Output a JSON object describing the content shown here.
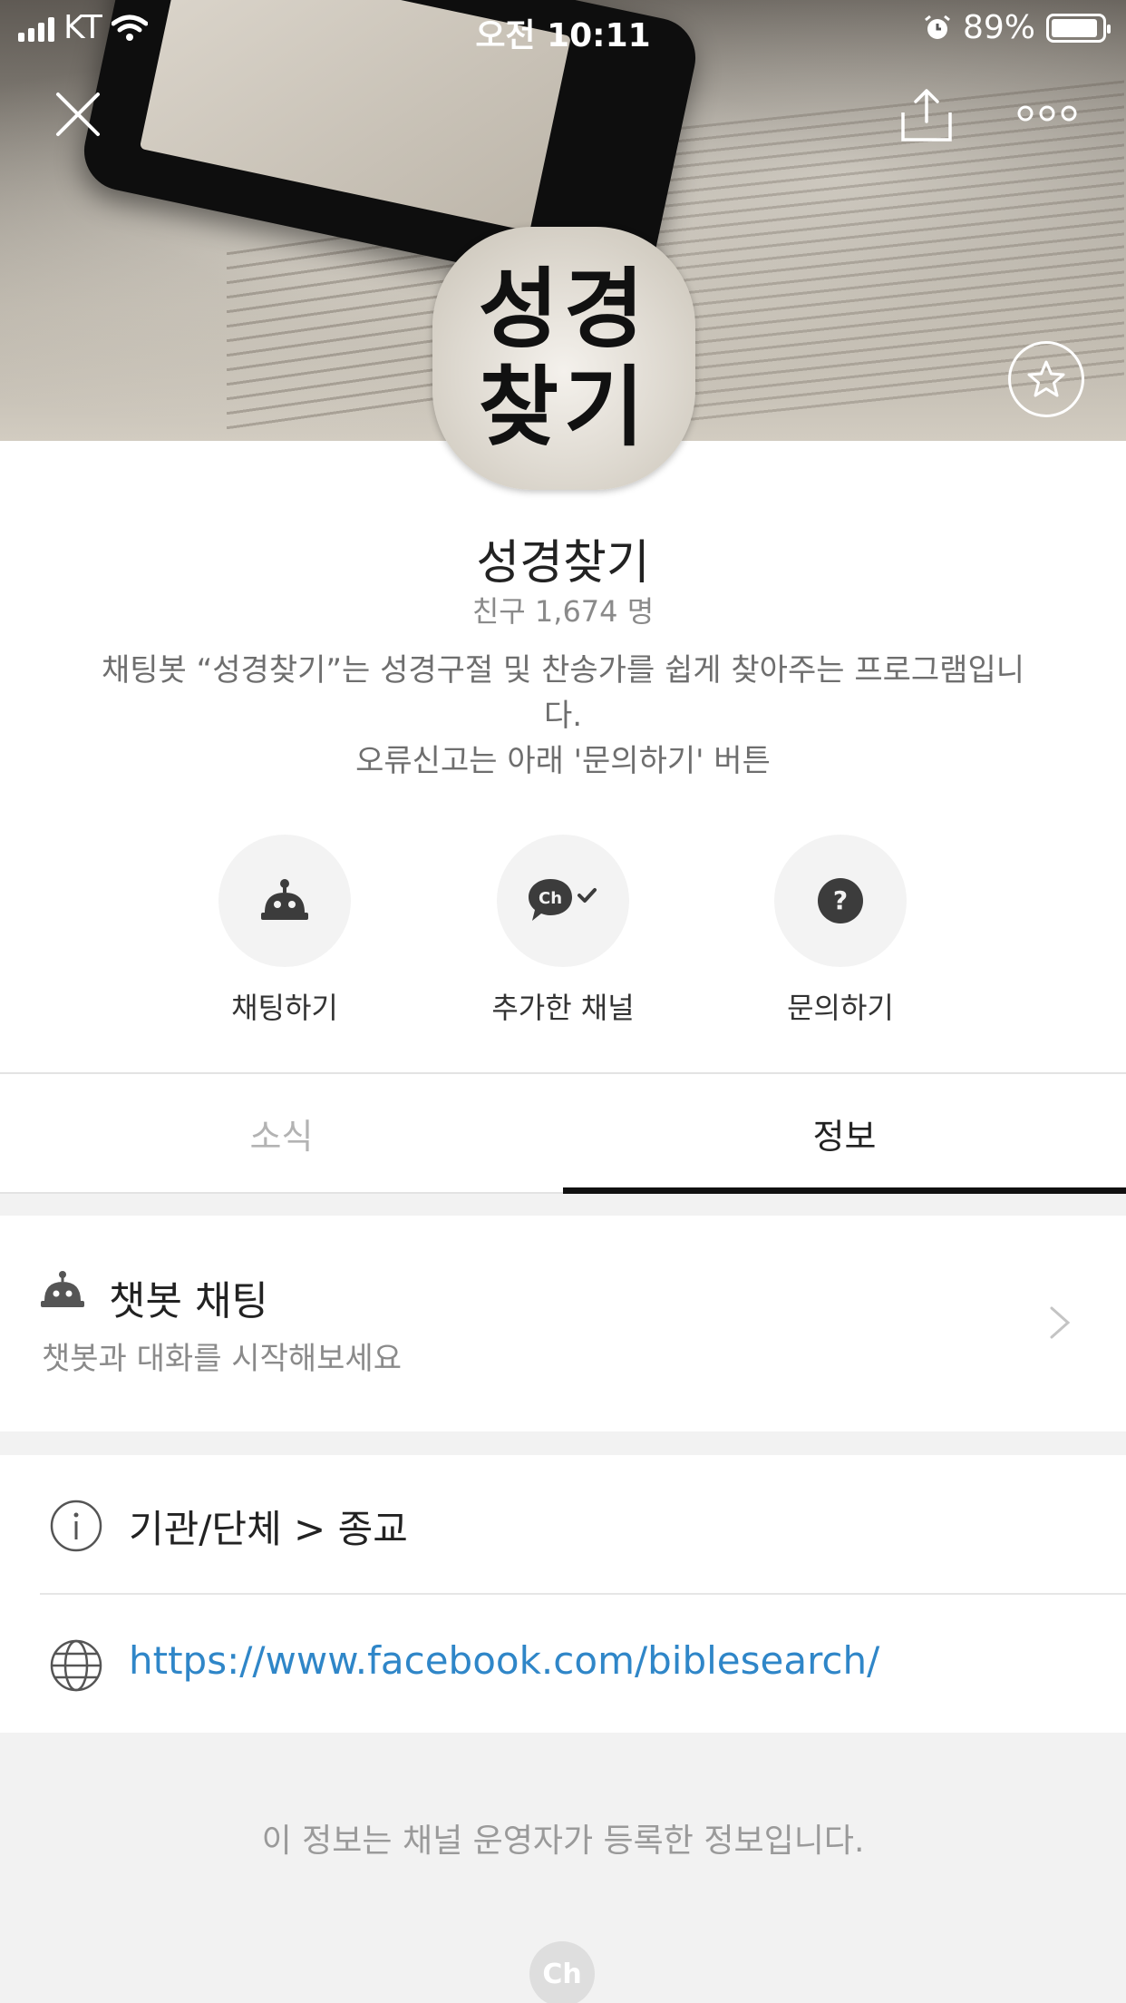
{
  "status_bar": {
    "carrier": "KT",
    "time": "오전 10:11",
    "battery": "89%"
  },
  "profile": {
    "avatar_text_line1": "성경",
    "avatar_text_line2": "찾기",
    "name": "성경찾기",
    "friends": "친구 1,674 명",
    "description": "채팅봇 “성경찾기”는 성경구절 및 찬송가를 쉽게 찾아주는 프로그램입니다.",
    "description_line2": "오류신고는 아래 '문의하기' 버튼"
  },
  "actions": [
    {
      "label": "채팅하기",
      "icon": "robot-icon"
    },
    {
      "label": "추가한 채널",
      "icon": "channel-added-icon"
    },
    {
      "label": "문의하기",
      "icon": "question-icon"
    }
  ],
  "tabs": {
    "news": "소식",
    "info": "정보",
    "active": "info"
  },
  "chatbot": {
    "title": "챗봇 채팅",
    "subtitle": "챗봇과 대화를 시작해보세요"
  },
  "info": {
    "category": "기관/단체 > 종교",
    "url": "https://www.facebook.com/biblesearch/"
  },
  "footer": {
    "note": "이 정보는 채널 운영자가 등록한 정보입니다.",
    "logo": "Ch"
  },
  "colors": {
    "link": "#2f86c8",
    "tab_indicator": "#111111",
    "background": "#f2f2f2"
  }
}
